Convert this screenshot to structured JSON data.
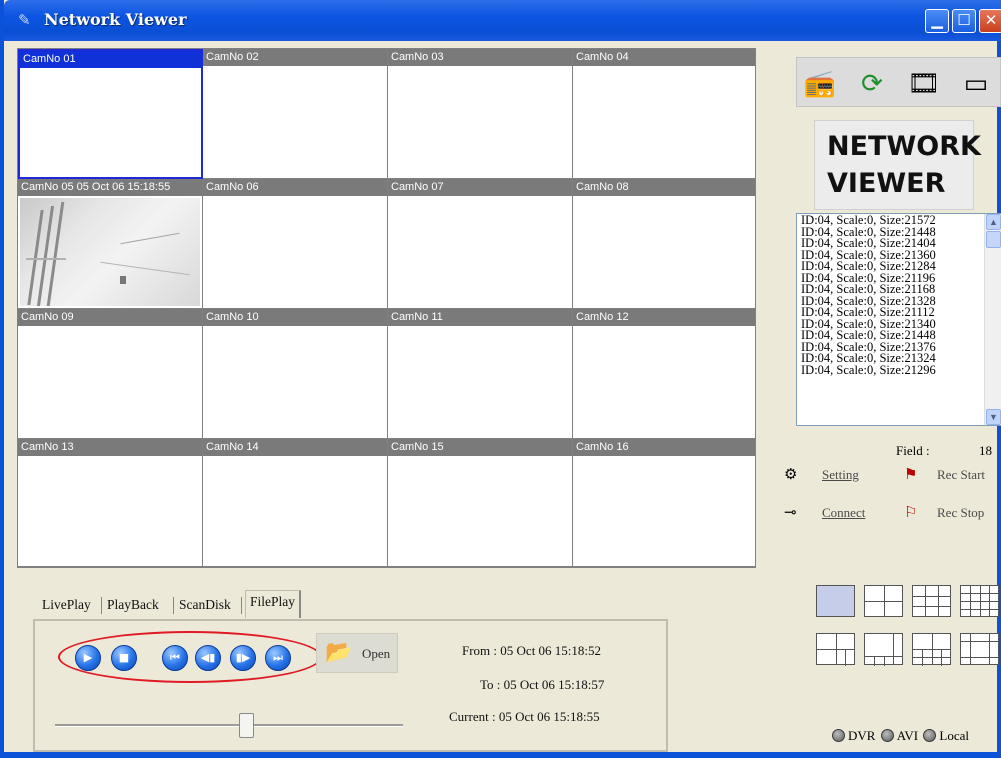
{
  "window": {
    "title": "Network Viewer",
    "app_icon": "camera-icon",
    "buttons": {
      "minimize": "minimize-icon",
      "maximize": "maximize-icon",
      "close": "close-icon"
    }
  },
  "cameras": [
    {
      "label": "CamNo 01"
    },
    {
      "label": "CamNo 02"
    },
    {
      "label": "CamNo 03"
    },
    {
      "label": "CamNo 04"
    },
    {
      "label": "CamNo 05 05 Oct 06 15:18:55"
    },
    {
      "label": "CamNo 06"
    },
    {
      "label": "CamNo 07"
    },
    {
      "label": "CamNo 08"
    },
    {
      "label": "CamNo 09"
    },
    {
      "label": "CamNo 10"
    },
    {
      "label": "CamNo 11"
    },
    {
      "label": "CamNo 12"
    },
    {
      "label": "CamNo 13"
    },
    {
      "label": "CamNo 14"
    },
    {
      "label": "CamNo 15"
    },
    {
      "label": "CamNo 16"
    }
  ],
  "toolbar_icons": [
    "radio-icon",
    "refresh-icon",
    "avi-icon",
    "dvr-device-icon"
  ],
  "logo": {
    "line1": "NETWORK",
    "line2": "VIEWER"
  },
  "log": [
    "ID:04, Scale:0, Size:21572",
    "ID:04, Scale:0, Size:21448",
    "ID:04, Scale:0, Size:21404",
    "ID:04, Scale:0, Size:21360",
    "ID:04, Scale:0, Size:21284",
    "ID:04, Scale:0, Size:21196",
    "ID:04, Scale:0, Size:21168",
    "ID:04, Scale:0, Size:21328",
    "ID:04, Scale:0, Size:21112",
    "ID:04, Scale:0, Size:21340",
    "ID:04, Scale:0, Size:21448",
    "ID:04, Scale:0, Size:21376",
    "ID:04, Scale:0, Size:21324",
    "ID:04, Scale:0, Size:21296"
  ],
  "field": {
    "label": "Field :",
    "value": "18"
  },
  "controls": {
    "setting": "Setting",
    "connect": "Connect",
    "rec_start": "Rec Start",
    "rec_stop": "Rec Stop"
  },
  "sources": {
    "dvr": "DVR",
    "avi": "AVI",
    "local": "Local"
  },
  "tabs": [
    "LivePlay",
    "PlayBack",
    "ScanDisk",
    "FilePlay"
  ],
  "fileplay": {
    "open_label": "Open",
    "from": "From : 05 Oct 06 15:18:52",
    "to": "To : 05 Oct 06 15:18:57",
    "current": "Current : 05 Oct 06 15:18:55",
    "position": 0.55
  },
  "colors": {
    "titlebar": "#0a52d8",
    "active_cam": "#1030d8",
    "highlight": "#e01b24"
  }
}
